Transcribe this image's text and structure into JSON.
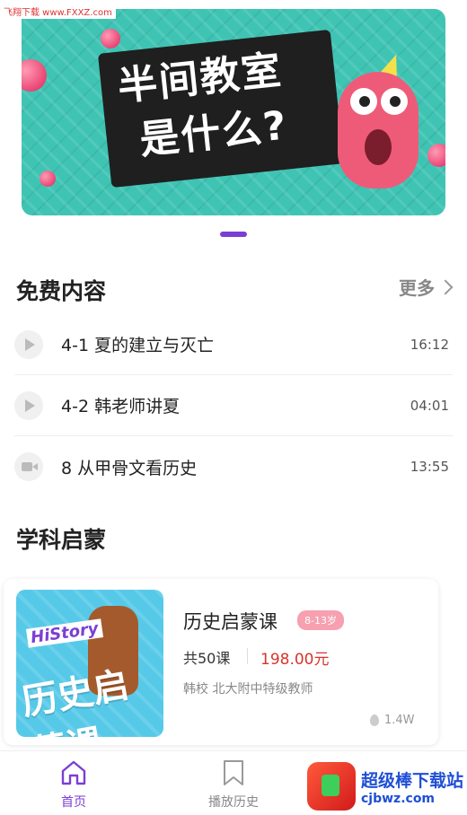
{
  "watermark_top": "飞翔下载 www.FXXZ.com",
  "banner": {
    "title_line1": "半间教室",
    "title_line2": "是什么?"
  },
  "free": {
    "title": "免费内容",
    "more_label": "更多",
    "items": [
      {
        "title": "4-1 夏的建立与灭亡",
        "duration": "16:12",
        "icon": "play-icon"
      },
      {
        "title": "4-2 韩老师讲夏",
        "duration": "04:01",
        "icon": "play-icon"
      },
      {
        "title": "8 从甲骨文看历史",
        "duration": "13:55",
        "icon": "video-camera-icon"
      }
    ]
  },
  "subject": {
    "title": "学科启蒙",
    "course": {
      "thumb_history": "HiStory",
      "thumb_zh": "历史启蒙课",
      "title": "历史启蒙课",
      "age": "8-13岁",
      "lessons": "共50课",
      "price": "198.00元",
      "teacher": "韩校  北大附中特级教师",
      "views": "1.4W"
    }
  },
  "tabbar": {
    "home": "首页",
    "history": "播放历史"
  },
  "watermark_br": {
    "main": "超级棒下载站",
    "sub": "cjbwz.com"
  },
  "colors": {
    "accent": "#7b3fd4",
    "price": "#d9342b",
    "age_badge": "#f6a0b0"
  }
}
